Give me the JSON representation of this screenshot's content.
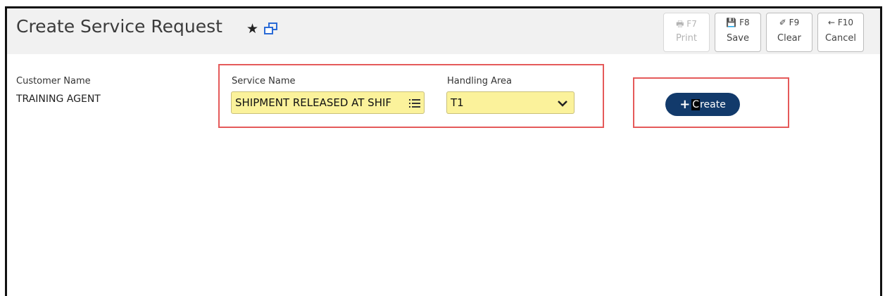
{
  "header": {
    "title": "Create Service Request",
    "star_glyph": "★",
    "fkeys": [
      {
        "key": "F7",
        "label": "Print",
        "icon": "printer-icon",
        "glyph": "🖶",
        "disabled": true
      },
      {
        "key": "F8",
        "label": "Save",
        "icon": "save-icon",
        "glyph": "💾",
        "disabled": false
      },
      {
        "key": "F9",
        "label": "Clear",
        "icon": "eraser-icon",
        "glyph": "✐",
        "disabled": false
      },
      {
        "key": "F10",
        "label": "Cancel",
        "icon": "arrow-left-icon",
        "glyph": "←",
        "disabled": false
      }
    ]
  },
  "form": {
    "customer_name_label": "Customer Name",
    "customer_name_value": "TRAINING AGENT",
    "service_name_label": "Service Name",
    "service_name_value": "SHIPMENT RELEASED AT SHIF",
    "handling_area_label": "Handling Area",
    "handling_area_value": "T1",
    "create_plus": "+",
    "create_first": "C",
    "create_rest": "reate"
  },
  "colors": {
    "field_bg": "#fbf29b",
    "button_bg": "#123a6b",
    "highlight_box": "#e55a5a"
  }
}
